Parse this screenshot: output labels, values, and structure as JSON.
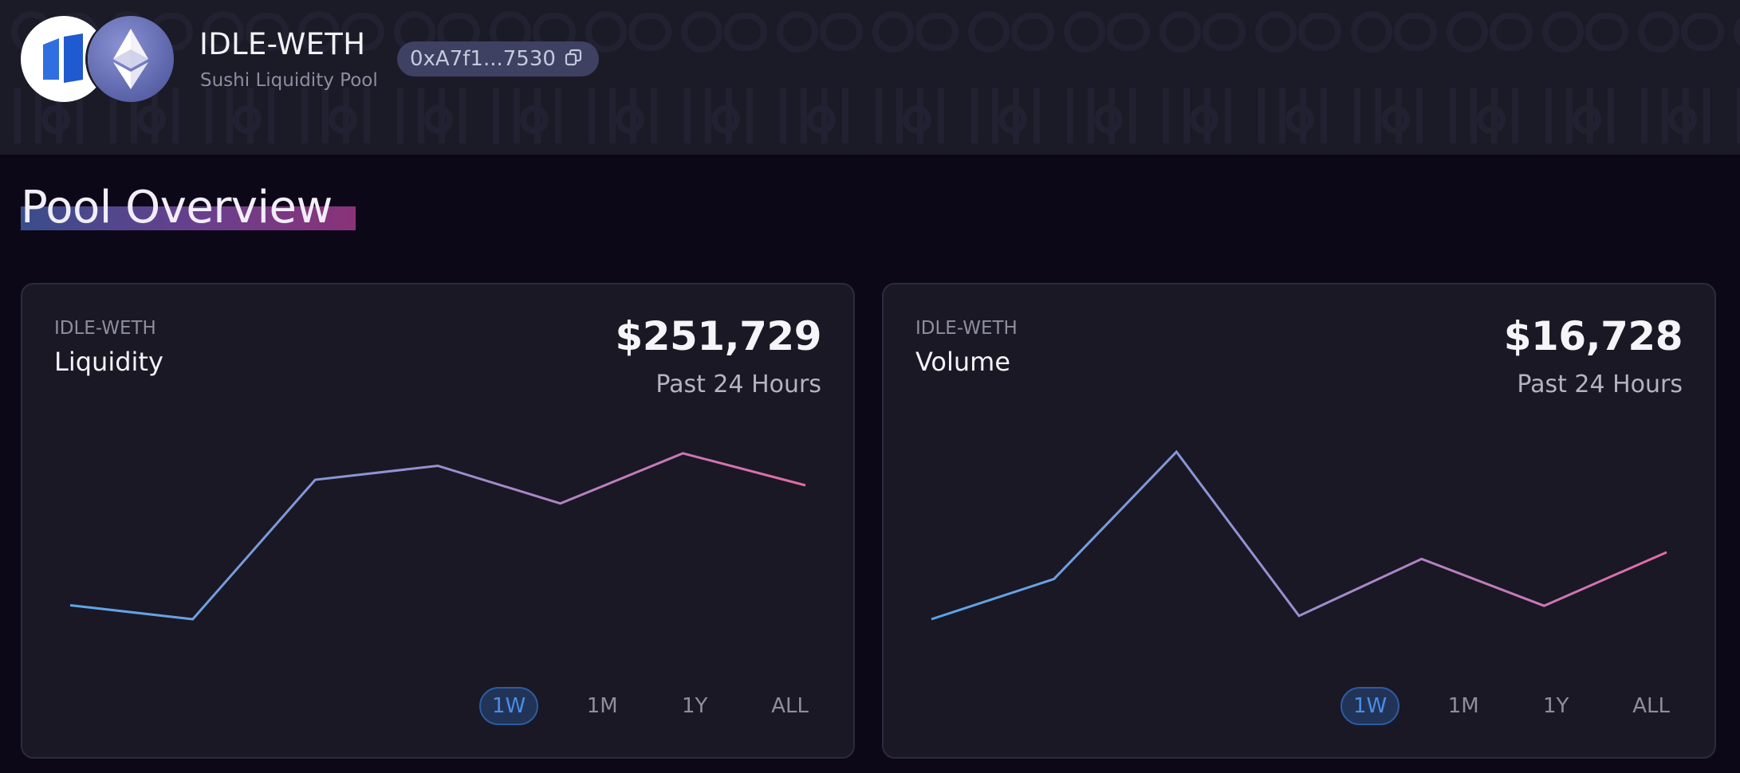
{
  "header": {
    "pool_name": "IDLE-WETH",
    "pool_subtitle": "Sushi Liquidity Pool",
    "address": "0xA7f1...7530",
    "icons": {
      "token_a": "idle-logo-icon",
      "token_b": "ethereum-logo-icon",
      "copy": "copy-icon"
    }
  },
  "page_title": "Pool Overview",
  "colors": {
    "background": "#0d0817",
    "header_bg": "#1b1a27",
    "card_bg": "#191824",
    "line_start": "#5aa6e8",
    "line_mid": "#9a8fd0",
    "line_end": "#e36aa9",
    "active_range": "#4a8de8"
  },
  "cards": [
    {
      "subtitle": "IDLE-WETH",
      "title": "Liquidity",
      "value": "$251,729",
      "period": "Past 24 Hours",
      "ranges": [
        "1W",
        "1M",
        "1Y",
        "ALL"
      ],
      "active_range": "1W"
    },
    {
      "subtitle": "IDLE-WETH",
      "title": "Volume",
      "value": "$16,728",
      "period": "Past 24 Hours",
      "ranges": [
        "1W",
        "1M",
        "1Y",
        "ALL"
      ],
      "active_range": "1W"
    }
  ],
  "chart_data": [
    {
      "type": "line",
      "title": "Liquidity",
      "x": [
        1,
        2,
        3,
        4,
        5,
        6,
        7
      ],
      "series": [
        {
          "values": [
            0.1,
            0.0,
            1.0,
            1.1,
            0.83,
            1.19,
            0.96
          ]
        }
      ],
      "ylim": [
        0,
        1.2
      ],
      "grid": false,
      "legend": "none"
    },
    {
      "type": "line",
      "title": "Volume",
      "x": [
        1,
        2,
        3,
        4,
        5,
        6,
        7
      ],
      "series": [
        {
          "values": [
            0.0,
            0.24,
            1.0,
            0.02,
            0.36,
            0.08,
            0.4
          ]
        }
      ],
      "ylim": [
        0,
        1.0
      ],
      "grid": false,
      "legend": "none"
    }
  ]
}
